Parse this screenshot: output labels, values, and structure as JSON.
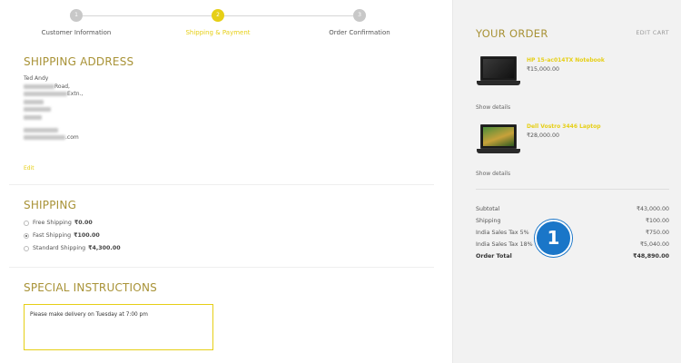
{
  "steps": [
    {
      "number": "1",
      "label": "Customer Information",
      "active": false
    },
    {
      "number": "2",
      "label": "Shipping & Payment",
      "active": true
    },
    {
      "number": "3",
      "label": "Order Confirmation",
      "active": false
    }
  ],
  "shipping_address": {
    "title": "SHIPPING ADDRESS",
    "name": "Ted Andy",
    "line1_tail": "Road,",
    "line2_tail": "Extn.,",
    "email_tail": ".com",
    "edit_label": "Edit"
  },
  "shipping": {
    "title": "SHIPPING",
    "options": [
      {
        "label": "Free Shipping",
        "price": "₹0.00",
        "selected": false
      },
      {
        "label": "Fast Shipping",
        "price": "₹100.00",
        "selected": true
      },
      {
        "label": "Standard Shipping",
        "price": "₹4,300.00",
        "selected": false
      }
    ]
  },
  "special_instructions": {
    "title": "SPECIAL INSTRUCTIONS",
    "value": "Please make delivery on Tuesday at 7:00 pm"
  },
  "order": {
    "title": "YOUR ORDER",
    "edit_cart_label": "EDIT CART",
    "items": [
      {
        "name": "HP 15-ac014TX Notebook",
        "price": "₹15,000.00",
        "details_label": "Show details"
      },
      {
        "name": "Dell Vostro 3446 Laptop",
        "price": "₹28,000.00",
        "details_label": "Show details"
      }
    ],
    "totals": [
      {
        "label": "Subtotal",
        "value": "₹43,000.00"
      },
      {
        "label": "Shipping",
        "value": "₹100.00"
      },
      {
        "label": "India Sales Tax 5%",
        "value": "₹750.00"
      },
      {
        "label": "India Sales Tax 18%",
        "value": "₹5,040.00"
      },
      {
        "label": "Order Total",
        "value": "₹48,890.00"
      }
    ]
  },
  "annotation": {
    "badge_number": "1",
    "badge_color": "#1a76c8"
  },
  "colors": {
    "accent": "#e6cf16",
    "heading": "#a89236"
  }
}
